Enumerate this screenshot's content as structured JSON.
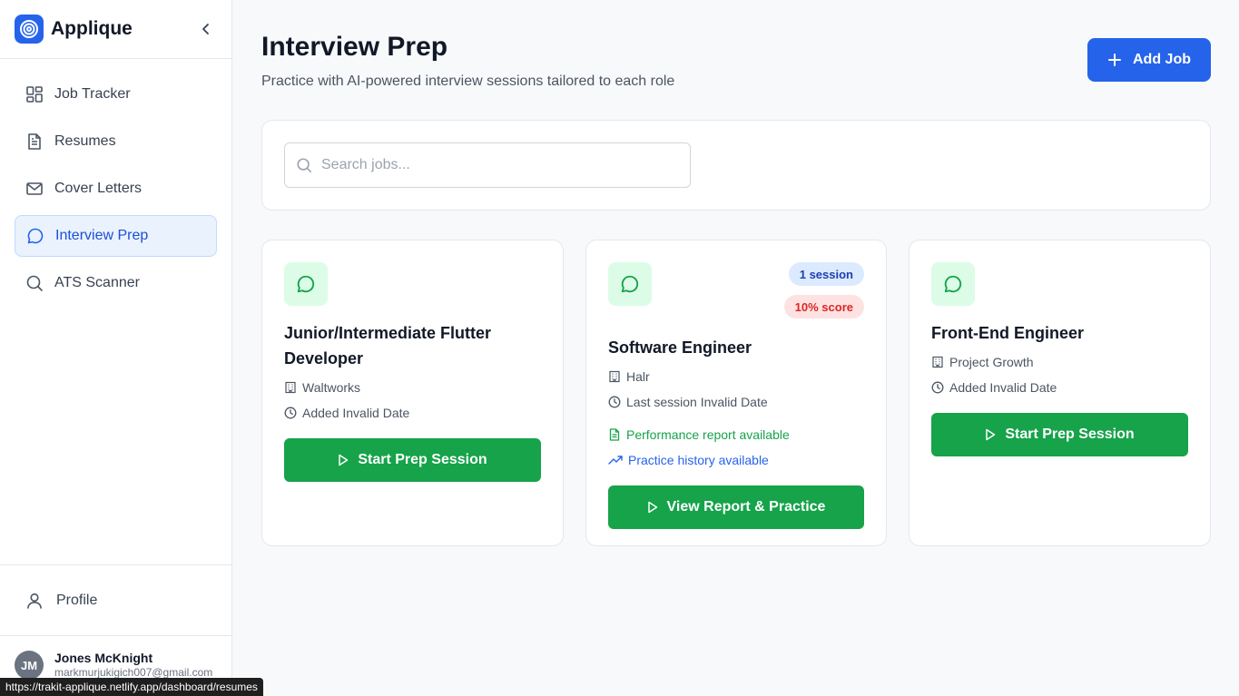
{
  "app": {
    "name": "Applique"
  },
  "sidebar": {
    "items": [
      {
        "label": "Job Tracker"
      },
      {
        "label": "Resumes"
      },
      {
        "label": "Cover Letters"
      },
      {
        "label": "Interview Prep",
        "active": true
      },
      {
        "label": "ATS Scanner"
      }
    ],
    "profile_label": "Profile",
    "user": {
      "initials": "JM",
      "name": "Jones McKnight",
      "email": "markmurjukigich007@gmail.com"
    }
  },
  "status_bar": {
    "url": "https://trakit-applique.netlify.app/dashboard/resumes"
  },
  "header": {
    "title": "Interview Prep",
    "subtitle": "Practice with AI-powered interview sessions tailored to each role",
    "add_job_label": "Add Job"
  },
  "search": {
    "placeholder": "Search jobs...",
    "value": ""
  },
  "jobs": [
    {
      "title": "Junior/Intermediate Flutter Developer",
      "company": "Waltworks",
      "date_text": "Added Invalid Date",
      "button_label": "Start Prep Session"
    },
    {
      "title": "Software Engineer",
      "company": "Halr",
      "date_text": "Last session Invalid Date",
      "sessions_badge": "1 session",
      "score_badge": "10% score",
      "report_text": "Performance report available",
      "history_text": "Practice history available",
      "button_label": "View Report & Practice"
    },
    {
      "title": "Front-End Engineer",
      "company": "Project Growth",
      "date_text": "Added Invalid Date",
      "button_label": "Start Prep Session"
    }
  ],
  "colors": {
    "primary": "#2563eb",
    "success": "#16a34a",
    "danger": "#dc2626"
  }
}
